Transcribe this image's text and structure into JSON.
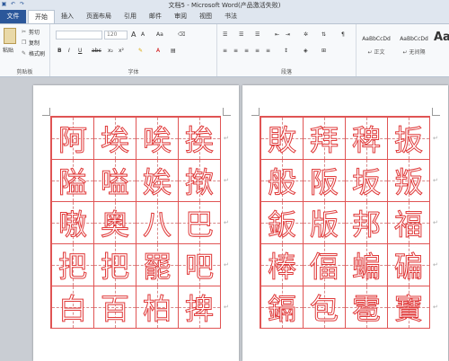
{
  "window": {
    "title": "文档5 - Microsoft Word(产品激活失败)"
  },
  "quick_access": {
    "save_icon": "save-icon",
    "undo_icon": "undo-icon",
    "redo_icon": "redo-icon"
  },
  "tabs": {
    "file": "文件",
    "items": [
      "开始",
      "插入",
      "页面布局",
      "引用",
      "邮件",
      "审阅",
      "视图",
      "书法"
    ],
    "active_index": 0
  },
  "clipboard": {
    "paste": "粘贴",
    "cut": "剪切",
    "copy": "复制",
    "format_painter": "格式刷",
    "label": "剪贴板"
  },
  "font": {
    "name_value": "",
    "size_value": "120",
    "grow": "A",
    "shrink": "A",
    "change_case": "Aa",
    "bold": "B",
    "italic": "I",
    "underline": "U",
    "strike": "abc",
    "subscript": "x₂",
    "superscript": "x²",
    "label": "字体"
  },
  "paragraph": {
    "label": "段落"
  },
  "styles": {
    "items": [
      {
        "sample": "AaBbCcDd",
        "name": "↵ 正文"
      },
      {
        "sample": "AaBbCcDd",
        "name": "↵ 无间隔"
      },
      {
        "sample": "Aa",
        "name": ""
      }
    ]
  },
  "pages": [
    {
      "chars": [
        "阿",
        "埃",
        "唉",
        "挨",
        "隘",
        "嗌",
        "娭",
        "揿",
        "嗷",
        "奥",
        "八",
        "巴",
        "把",
        "把",
        "罷",
        "吧",
        "白",
        "百",
        "柏",
        "捭"
      ]
    },
    {
      "chars": [
        "敗",
        "拜",
        "稗",
        "扳",
        "般",
        "阪",
        "坂",
        "叛",
        "鈑",
        "版",
        "邦",
        "福",
        "棒",
        "偪",
        "蝙",
        "碥",
        "鎘",
        "包",
        "雹",
        "寶"
      ]
    }
  ],
  "colors": {
    "accent": "#2b579a",
    "grid": "#e05454",
    "glyph_outline": "#e03a3a"
  }
}
